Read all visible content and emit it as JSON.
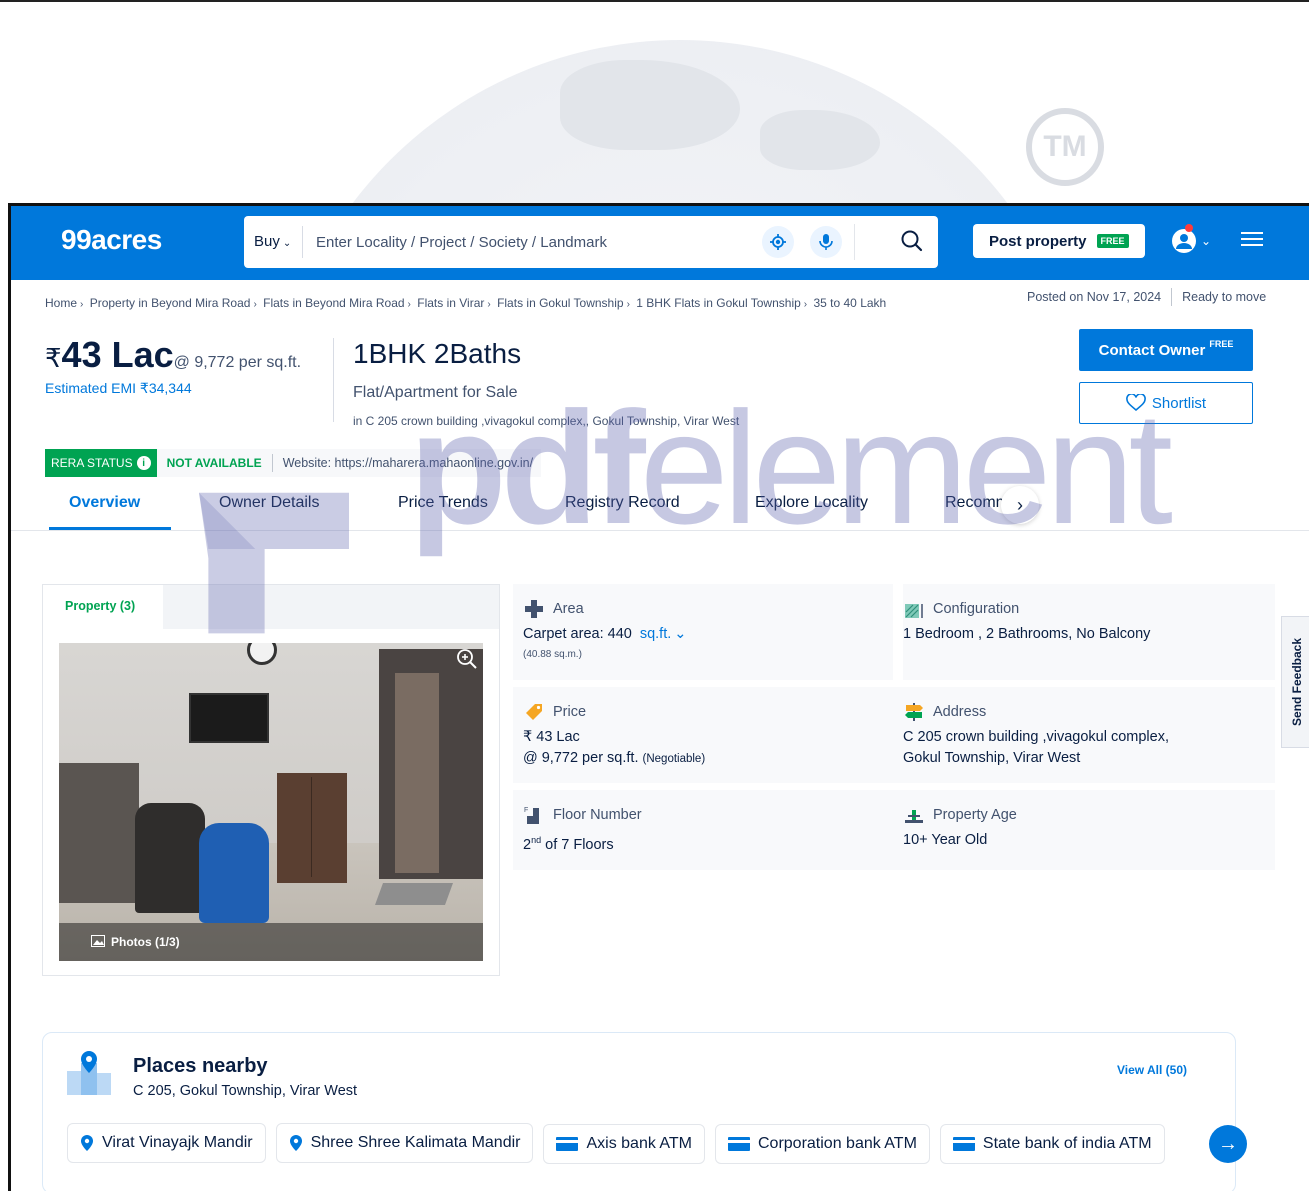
{
  "watermark_tm": "TM",
  "header": {
    "logo": "99acres",
    "buy_label": "Buy",
    "search_placeholder": "Enter Locality / Project / Society / Landmark",
    "post_property": "Post property",
    "free_badge": "FREE"
  },
  "breadcrumb": [
    "Home",
    "Property in Beyond Mira Road",
    "Flats in Beyond Mira Road",
    "Flats in Virar",
    "Flats in Gokul Township",
    "1 BHK Flats in Gokul Township",
    "35 to 40 Lakh"
  ],
  "posting": {
    "posted_on": "Posted on Nov 17, 2024",
    "status": "Ready to move"
  },
  "price": {
    "currency": "₹",
    "amount": "43 Lac",
    "per_sqft": "@ 9,772 per sq.ft.",
    "emi": "Estimated EMI ₹34,344"
  },
  "listing": {
    "title": "1BHK 2Baths",
    "type": "Flat/Apartment for Sale",
    "address": "in C 205 crown building ,vivagokul complex,, Gokul Township, Virar West"
  },
  "actions": {
    "contact_owner": "Contact Owner",
    "contact_free": "FREE",
    "shortlist": "Shortlist"
  },
  "rera": {
    "status_label": "RERA STATUS",
    "status": "NOT AVAILABLE",
    "website": "Website: https://maharera.mahaonline.gov.in/"
  },
  "tabs": [
    "Overview",
    "Owner Details",
    "Price Trends",
    "Registry Record",
    "Explore Locality",
    "Recomm."
  ],
  "gallery": {
    "tab_label": "Property (3)",
    "photos_count": "Photos (1/3)"
  },
  "details": {
    "area": {
      "label": "Area",
      "value": "Carpet area: 440",
      "unit": "sq.ft.",
      "sub": "(40.88 sq.m.)"
    },
    "configuration": {
      "label": "Configuration",
      "value": "1 Bedroom , 2 Bathrooms, No Balcony"
    },
    "price": {
      "label": "Price",
      "value": "₹ 43 Lac",
      "value2": "@ 9,772 per sq.ft.",
      "note": "(Negotiable)"
    },
    "address": {
      "label": "Address",
      "line1": "C 205 crown building ,vivagokul complex,",
      "line2": "Gokul Township, Virar West"
    },
    "floor": {
      "label": "Floor Number",
      "floor_num": "2",
      "floor_suffix": "nd",
      "value": "of 7 Floors"
    },
    "age": {
      "label": "Property Age",
      "value": "10+ Year Old"
    }
  },
  "feedback": "Send Feedback",
  "places": {
    "title": "Places nearby",
    "subtitle": "C 205, Gokul Township, Virar West",
    "view_all": "View All (50)",
    "chips": [
      {
        "icon": "location-pin-icon",
        "label": "Virat Vinayajk Mandir"
      },
      {
        "icon": "location-pin-icon",
        "label": "Shree Shree Kalimata Mandir"
      },
      {
        "icon": "atm-card-icon",
        "label": "Axis bank ATM"
      },
      {
        "icon": "atm-card-icon",
        "label": "Corporation bank ATM"
      },
      {
        "icon": "atm-card-icon",
        "label": "State bank of india ATM"
      }
    ]
  },
  "overlay_watermark": {
    "bold": "pdf",
    "light": "element"
  },
  "colors": {
    "brand": "#0078db",
    "green": "#00a352",
    "text": "#091e42",
    "muted": "#42526e"
  }
}
